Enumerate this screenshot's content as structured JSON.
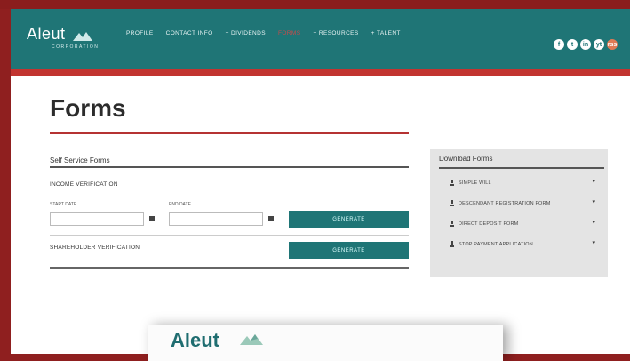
{
  "header": {
    "logo_word": "Aleut",
    "logo_sub": "CORPORATION",
    "nav": [
      {
        "label": "PROFILE",
        "active": false
      },
      {
        "label": "CONTACT INFO",
        "active": false
      },
      {
        "label": "+ DIVIDENDS",
        "active": false
      },
      {
        "label": "FORMS",
        "active": true
      },
      {
        "label": "+ RESOURCES",
        "active": false
      },
      {
        "label": "+ TALENT",
        "active": false
      }
    ],
    "social": [
      "f",
      "t",
      "in",
      "yt",
      "rss"
    ]
  },
  "page": {
    "title": "Forms"
  },
  "self_service": {
    "title": "Self Service Forms",
    "income_label": "INCOME VERIFICATION",
    "start_date_label": "START DATE",
    "end_date_label": "END DATE",
    "start_date_value": "",
    "end_date_value": "",
    "generate_label": "GENERATE",
    "shareholder_label": "SHAREHOLDER VERIFICATION",
    "generate2_label": "GENERATE"
  },
  "download": {
    "title": "Download Forms",
    "items": [
      {
        "label": "SIMPLE WILL"
      },
      {
        "label": "DESCENDANT REGISTRATION FORM"
      },
      {
        "label": "DIRECT DEPOSIT FORM"
      },
      {
        "label": "STOP PAYMENT APPLICATION"
      }
    ]
  },
  "preview": {
    "word": "Aleut"
  },
  "colors": {
    "teal": "#1f7576",
    "red": "#c23430",
    "frame": "#8f1f1f"
  }
}
